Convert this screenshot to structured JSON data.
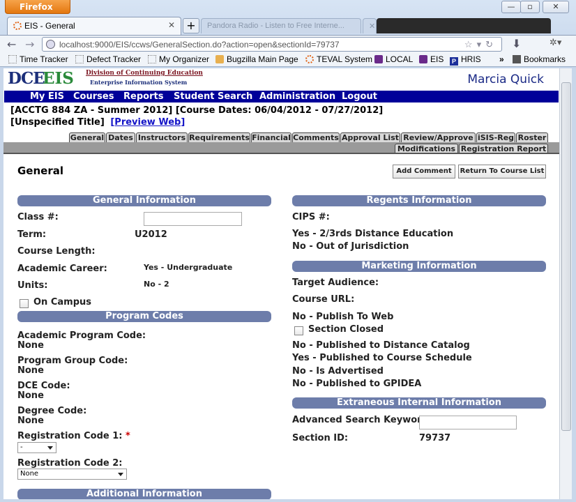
{
  "browser": {
    "app_button": "Firefox",
    "window_buttons": [
      "—",
      "▫",
      "✕"
    ],
    "active_tab": "EIS - General",
    "background_tabs": [
      "Pandora Radio - Listen to Free Interne...",
      ""
    ],
    "url": "localhost:9000/EIS/ccws/GeneralSection.do?action=open&sectionId=79737",
    "bookmarks": [
      "Time Tracker",
      "Defect Tracker",
      "My Organizer",
      "Bugzilla Main Page",
      "TEVAL System",
      "LOCAL",
      "EIS",
      "HRIS"
    ],
    "bookmarks_overflow": "»",
    "bookmarks_menu": "Bookmarks"
  },
  "header": {
    "logo_dce": "DCE",
    "logo_eis": "EIS",
    "logo_line1": "Division of Continuing Education",
    "logo_line2": "Enterprise Information System",
    "user_name": "Marcia Quick"
  },
  "menu": [
    "My EIS",
    "Courses",
    "Reports",
    "Student Search",
    "Administration",
    "Logout"
  ],
  "course": {
    "line1": "[ACCTG 884 ZA - Summer 2012] [Course Dates: 06/04/2012 - 07/27/2012]",
    "line2": "[Unspecified Title]",
    "preview_link": "[Preview Web]"
  },
  "page_tabs_row1": [
    "General",
    "Dates",
    "Instructors",
    "Requirements",
    "Financial",
    "Comments",
    "Approval List",
    "Review/Approve",
    "iSIS-Reg",
    "Roster"
  ],
  "page_tabs_row2": [
    "Modifications",
    "Registration Report"
  ],
  "page_title": "General",
  "buttons": {
    "add_comment": "Add Comment",
    "return": "Return To Course List"
  },
  "general_info": {
    "header": "General Information",
    "class_label": "Class #:",
    "class_value": "",
    "term_label": "Term:",
    "term_value": "U2012",
    "course_length_label": "Course Length:",
    "academic_career_label": "Academic Career:",
    "academic_career_value": "Yes - Undergraduate",
    "units_label": "Units:",
    "units_value": "No - 2",
    "on_campus_label": "On Campus",
    "on_campus_checked": false
  },
  "program_codes": {
    "header": "Program Codes",
    "academic_program_label": "Academic Program Code:",
    "academic_program_value": "None",
    "program_group_label": "Program Group Code:",
    "program_group_value": "None",
    "dce_label": "DCE Code:",
    "dce_value": "None",
    "degree_label": "Degree Code:",
    "degree_value": "None",
    "reg_code1_label": "Registration Code 1:",
    "reg_code1_required": "*",
    "reg_code1_value": "-",
    "reg_code2_label": "Registration Code 2:",
    "reg_code2_value": "None"
  },
  "additional_info": {
    "header": "Additional Information"
  },
  "regents_info": {
    "header": "Regents Information",
    "cips_label": "CIPS #:",
    "distance_ed": "Yes - 2/3rds Distance Education",
    "jurisdiction": "No - Out of Jurisdiction"
  },
  "marketing_info": {
    "header": "Marketing Information",
    "target_audience_label": "Target Audience:",
    "course_url_label": "Course URL:",
    "publish_web": "No - Publish To Web",
    "section_closed_label": "Section Closed",
    "section_closed_checked": false,
    "distance_catalog": "No - Published to Distance Catalog",
    "course_schedule": "Yes - Published to Course Schedule",
    "advertised": "No - Is Advertised",
    "gpidea": "No - Published to GPIDEA"
  },
  "extraneous_info": {
    "header": "Extraneous Internal Information",
    "search_keyword_label": "Advanced Search Keyword:",
    "search_keyword_value": "",
    "section_id_label": "Section ID:",
    "section_id_value": "79737"
  }
}
